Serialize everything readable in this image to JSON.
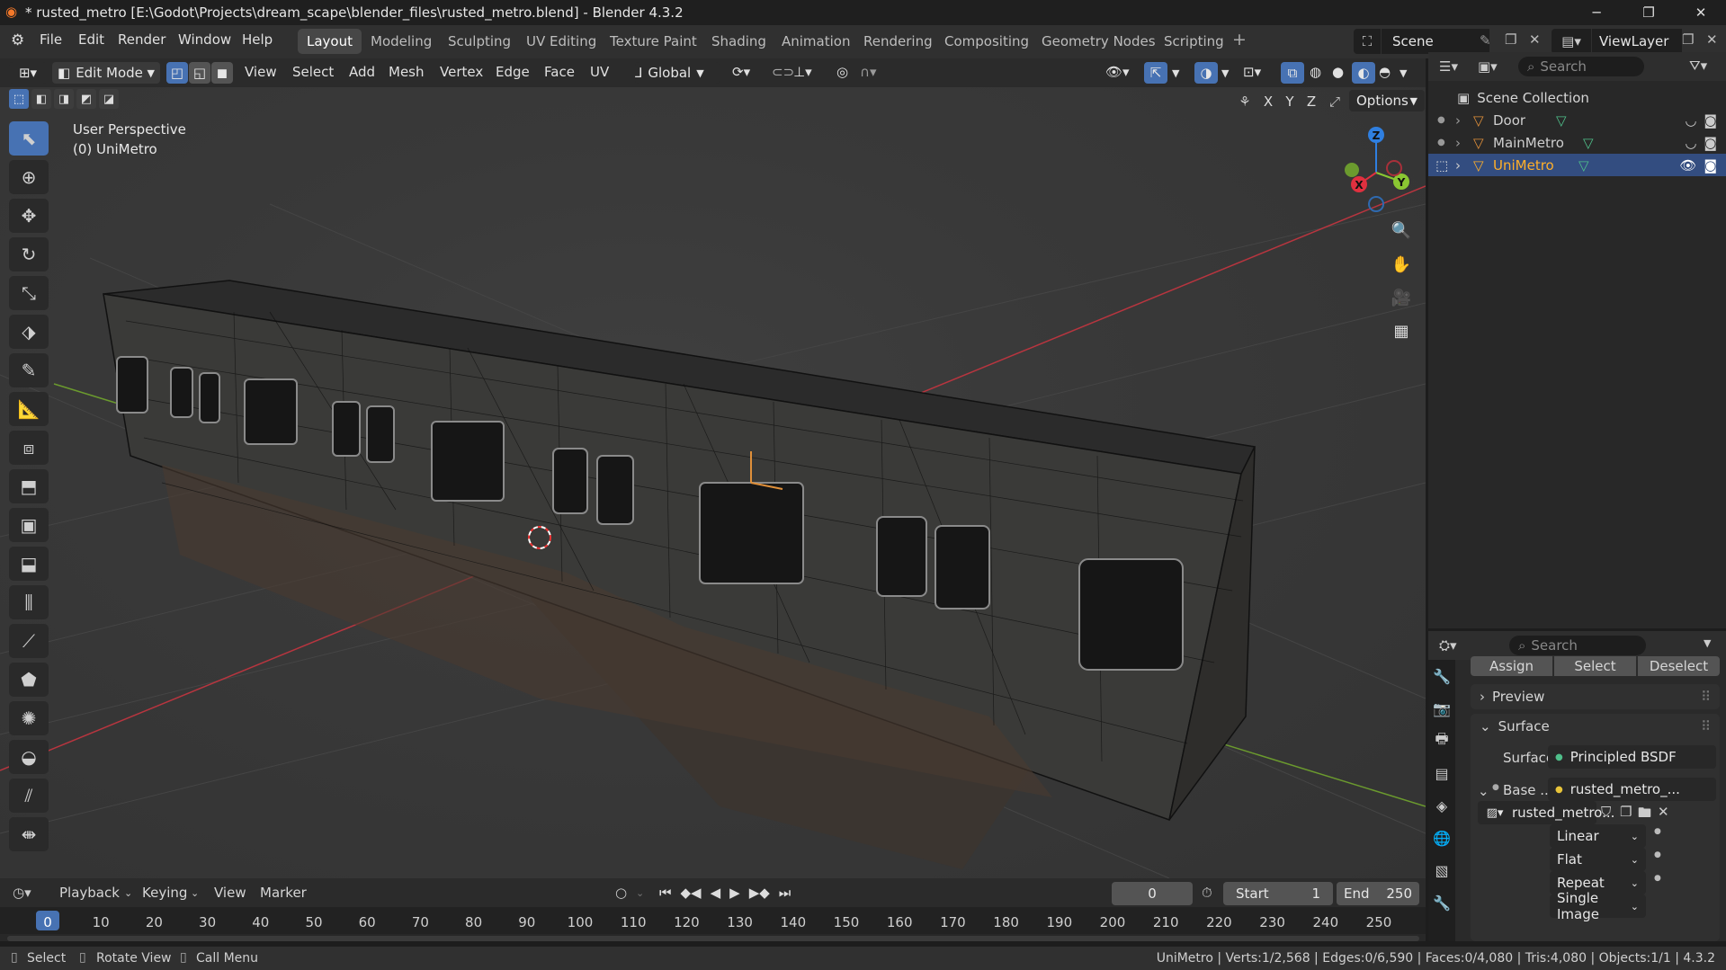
{
  "title_bar": {
    "title": "* rusted_metro [E:\\Godot\\Projects\\dream_scape\\blender_files\\rusted_metro.blend] - Blender 4.3.2",
    "icon": "blender-logo-icon",
    "controls": [
      "minimize",
      "maximize",
      "close"
    ]
  },
  "menu": {
    "items": [
      "File",
      "Edit",
      "Render",
      "Window",
      "Help"
    ]
  },
  "workspaces": {
    "tabs": [
      "Layout",
      "Modeling",
      "Sculpting",
      "UV Editing",
      "Texture Paint",
      "Shading",
      "Animation",
      "Rendering",
      "Compositing",
      "Geometry Nodes",
      "Scripting"
    ],
    "active": "Layout"
  },
  "scene": {
    "label": "Scene"
  },
  "view_layer": {
    "label": "ViewLayer"
  },
  "viewport_header": {
    "mode": "Edit Mode",
    "menus": [
      "View",
      "Select",
      "Add",
      "Mesh",
      "Vertex",
      "Edge",
      "Face",
      "UV"
    ],
    "transform_orientation": "Global",
    "axis_labels": [
      "X",
      "Y",
      "Z"
    ],
    "options_label": "Options"
  },
  "viewport": {
    "perspective": "User Perspective",
    "object_label": "(0) UniMetro",
    "gizmo": {
      "z": "Z",
      "y": "Y",
      "x": "X"
    }
  },
  "tools": [
    "select-box-icon",
    "cursor-icon",
    "move-icon",
    "rotate-icon",
    "scale-icon",
    "transform-icon",
    "annotate-icon",
    "measure-icon",
    "add-cube-icon",
    "extrude-icon",
    "inset-icon",
    "bevel-icon",
    "loop-cut-icon",
    "knife-icon",
    "poly-build-icon",
    "spin-icon",
    "smooth-icon",
    "edge-slide-icon",
    "shrink-fatten-icon"
  ],
  "outliner": {
    "search_placeholder": "Search",
    "collection": "Scene Collection",
    "items": [
      {
        "name": "Door",
        "selected": false
      },
      {
        "name": "MainMetro",
        "selected": false
      },
      {
        "name": "UniMetro",
        "selected": true
      }
    ]
  },
  "properties": {
    "search_placeholder": "Search",
    "buttons": [
      "Assign",
      "Select",
      "Deselect"
    ],
    "preview_label": "Preview",
    "surface_section": "Surface",
    "surface_label": "Surface",
    "surface_value": "Principled BSDF",
    "base_label": "Base ...",
    "base_value": "rusted_metro_...",
    "image_name": "rusted_metro...",
    "interpolation": "Linear",
    "projection": "Flat",
    "extension": "Repeat",
    "source": "Single Image"
  },
  "timeline": {
    "menus": [
      "Playback",
      "Keying",
      "View",
      "Marker"
    ],
    "current_frame": "0",
    "start_label": "Start",
    "start_value": "1",
    "end_label": "End",
    "end_value": "250",
    "ruler": [
      "0",
      "10",
      "20",
      "30",
      "40",
      "50",
      "60",
      "70",
      "80",
      "90",
      "100",
      "110",
      "120",
      "130",
      "140",
      "150",
      "160",
      "170",
      "180",
      "190",
      "200",
      "210",
      "220",
      "230",
      "240",
      "250"
    ]
  },
  "statusbar": {
    "hints": [
      "Select",
      "Rotate View",
      "Call Menu"
    ],
    "stats": "UniMetro | Verts:1/2,568 | Edges:0/6,590 | Faces:0/4,080 | Tris:4,080 | Objects:1/1 | 4.3.2"
  },
  "colors": {
    "accent": "#4772b3",
    "selected_text": "#ffaf29",
    "x_axis": "#e0303f",
    "y_axis": "#8ac732",
    "z_axis": "#2f7fe0"
  }
}
